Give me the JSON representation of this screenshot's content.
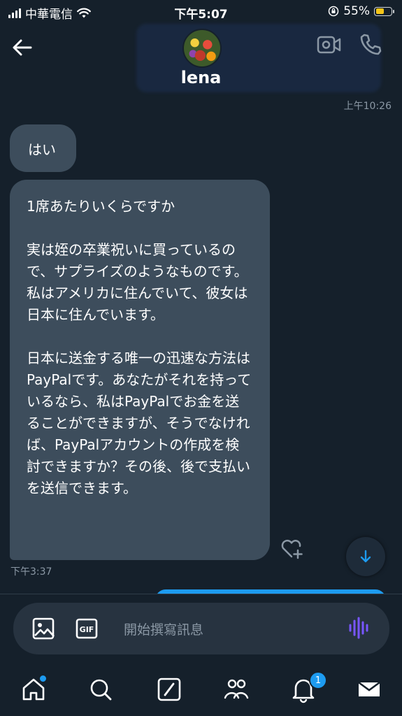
{
  "status_bar": {
    "carrier": "中華電信",
    "time": "下午5:07",
    "battery_percent": "55%"
  },
  "header": {
    "contact_name": "lena"
  },
  "messages": [
    {
      "timestamp": "上午10:26"
    },
    {
      "text": "はい"
    },
    {
      "text": "1席あたりいくらですか\n\n実は姪の卒業祝いに買っているので、サプライズのようなものです。私はアメリカに住んでいて、彼女は日本に住んでいます。\n\n日本に送金する唯一の迅速な方法はPayPalです。あなたがそれを持っているなら、私はPayPalでお金を送ることができますが、そうでなければ、PayPalアカウントの作成を検討できますか？その後、後で支払いを送信できます。"
    },
    {
      "timestamp": "下午3:37"
    }
  ],
  "composer": {
    "placeholder": "開始撰寫訊息",
    "gif_label": "GIF"
  },
  "tabbar": {
    "notifications_count": "1"
  },
  "colors": {
    "background": "#15202b",
    "bubble": "#3d4d5c",
    "accent": "#1d9bf0",
    "muted_text": "#8b98a5",
    "voice_icon": "#7856ff"
  },
  "icons": [
    "back-arrow-icon",
    "video-call-icon",
    "phone-icon",
    "add-reaction-icon",
    "arrow-down-icon",
    "image-icon",
    "gif-icon",
    "voice-wave-icon",
    "home-icon",
    "search-icon",
    "spaces-icon",
    "communities-icon",
    "bell-icon",
    "mail-icon"
  ]
}
